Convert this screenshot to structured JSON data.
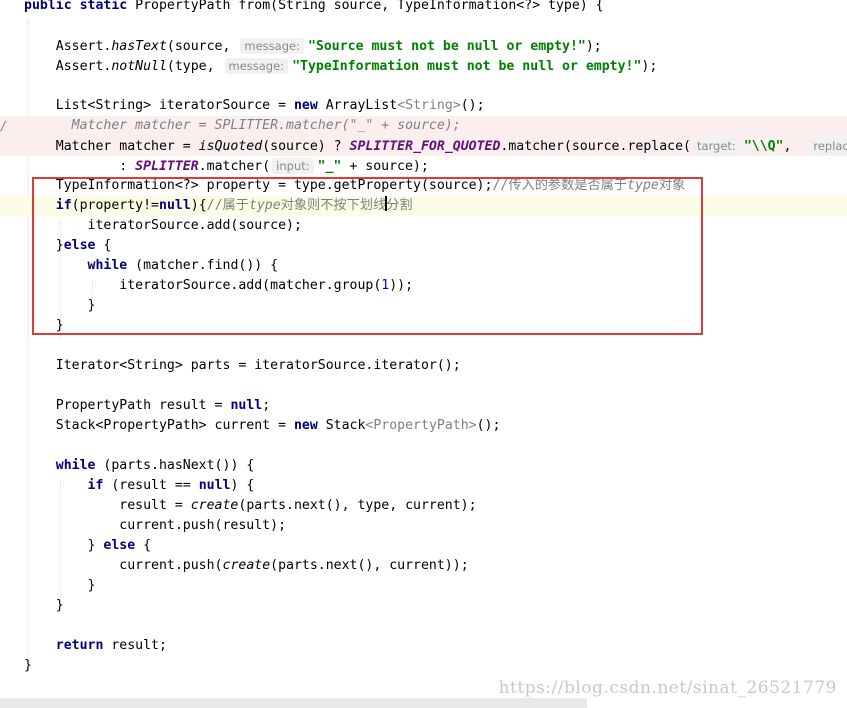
{
  "editor": {
    "gutter_marker": "/",
    "lines": [
      [
        {
          "t": "public static ",
          "c": "kw"
        },
        {
          "t": "PropertyPath from(String source, TypeInformation<?> type) {"
        }
      ],
      [],
      [
        {
          "t": "    Assert."
        },
        {
          "t": "hasText",
          "c": "ital"
        },
        {
          "t": "(source, "
        },
        {
          "t": "message:",
          "c": "hint"
        },
        {
          "t": "\"Source must not be null or empty!\"",
          "c": "str"
        },
        {
          "t": ");"
        }
      ],
      [
        {
          "t": "    Assert."
        },
        {
          "t": "notNull",
          "c": "ital"
        },
        {
          "t": "(type, "
        },
        {
          "t": "message:",
          "c": "hint"
        },
        {
          "t": "\"TypeInformation must not be null or empty!\"",
          "c": "str"
        },
        {
          "t": ");"
        }
      ],
      [],
      [
        {
          "t": "    List<String> iteratorSource = "
        },
        {
          "t": "new ",
          "c": "kw"
        },
        {
          "t": "ArrayList"
        },
        {
          "t": "<String>",
          "c": "gen"
        },
        {
          "t": "();"
        }
      ],
      [
        {
          "t": "      Matcher matcher = SPLITTER.matcher(\"_\" + source);",
          "c": "cmt"
        }
      ],
      [
        {
          "t": "    Matcher matcher = "
        },
        {
          "t": "isQuoted",
          "c": "ital"
        },
        {
          "t": "(source) ? "
        },
        {
          "t": "SPLITTER_FOR_QUOTED",
          "c": "const"
        },
        {
          "t": ".matcher(source.replace("
        },
        {
          "t": "target:",
          "c": "hint"
        },
        {
          "t": "\"\\\\Q\"",
          "c": "str"
        },
        {
          "t": ",  "
        },
        {
          "t": "replac",
          "c": "hint"
        }
      ],
      [
        {
          "t": "            : "
        },
        {
          "t": "SPLITTER",
          "c": "const"
        },
        {
          "t": ".matcher("
        },
        {
          "t": "input:",
          "c": "hint"
        },
        {
          "t": "\"_\"",
          "c": "str"
        },
        {
          "t": " + source);"
        }
      ],
      [
        {
          "t": "    TypeInformation<?> property = type.getProperty(source);"
        },
        {
          "t": "//传入的参数是否属于",
          "c": "cmt-plain"
        },
        {
          "t": "type",
          "c": "cmt"
        },
        {
          "t": "对象",
          "c": "cmt-plain"
        }
      ],
      [
        {
          "t": "    "
        },
        {
          "t": "if",
          "c": "kw"
        },
        {
          "t": "(property!="
        },
        {
          "t": "null",
          "c": "kw"
        },
        {
          "t": "){"
        },
        {
          "t": "//属于",
          "c": "cmt-plain"
        },
        {
          "t": "type",
          "c": "cmt"
        },
        {
          "t": "对象则不按下划线",
          "c": "cmt-plain"
        },
        {
          "t": "",
          "c": "caret"
        },
        {
          "t": "分割",
          "c": "cmt-plain"
        }
      ],
      [
        {
          "t": "        iteratorSource.add(source);"
        }
      ],
      [
        {
          "t": "    }"
        },
        {
          "t": "else ",
          "c": "kw"
        },
        {
          "t": "{"
        }
      ],
      [
        {
          "t": "        "
        },
        {
          "t": "while ",
          "c": "kw"
        },
        {
          "t": "(matcher.find()) {"
        }
      ],
      [
        {
          "t": "            iteratorSource.add(matcher.group("
        },
        {
          "t": "1",
          "c": "num"
        },
        {
          "t": "));"
        }
      ],
      [
        {
          "t": "        }"
        }
      ],
      [
        {
          "t": "    }"
        }
      ],
      [],
      [
        {
          "t": "    Iterator<String> parts = iteratorSource.iterator();"
        }
      ],
      [],
      [
        {
          "t": "    PropertyPath result = "
        },
        {
          "t": "null",
          "c": "kw"
        },
        {
          "t": ";"
        }
      ],
      [
        {
          "t": "    Stack<PropertyPath> current = "
        },
        {
          "t": "new ",
          "c": "kw"
        },
        {
          "t": "Stack"
        },
        {
          "t": "<PropertyPath>",
          "c": "gen"
        },
        {
          "t": "();"
        }
      ],
      [],
      [
        {
          "t": "    "
        },
        {
          "t": "while ",
          "c": "kw"
        },
        {
          "t": "(parts.hasNext()) {"
        }
      ],
      [
        {
          "t": "        "
        },
        {
          "t": "if ",
          "c": "kw"
        },
        {
          "t": "(result == "
        },
        {
          "t": "null",
          "c": "kw"
        },
        {
          "t": ") {"
        }
      ],
      [
        {
          "t": "            result = "
        },
        {
          "t": "create",
          "c": "ital"
        },
        {
          "t": "(parts.next(), type, current);"
        }
      ],
      [
        {
          "t": "            current.push(result);"
        }
      ],
      [
        {
          "t": "        } "
        },
        {
          "t": "else ",
          "c": "kw"
        },
        {
          "t": "{"
        }
      ],
      [
        {
          "t": "            current.push("
        },
        {
          "t": "create",
          "c": "ital"
        },
        {
          "t": "(parts.next(), current));"
        }
      ],
      [
        {
          "t": "        }"
        }
      ],
      [
        {
          "t": "    }"
        }
      ],
      [],
      [
        {
          "t": "    "
        },
        {
          "t": "return ",
          "c": "kw"
        },
        {
          "t": "result;"
        }
      ],
      [
        {
          "t": "}"
        }
      ]
    ],
    "highlighted_lines": {
      "pink": [
        6,
        7
      ],
      "yellow": [
        10
      ]
    },
    "comment_color": "#808080",
    "keyword_color": "#000080",
    "string_color": "#008000",
    "constant_color": "#660e7a",
    "selection_box_color": "#e0393b"
  },
  "watermark": "https://blog.csdn.net/sinat_26521779"
}
